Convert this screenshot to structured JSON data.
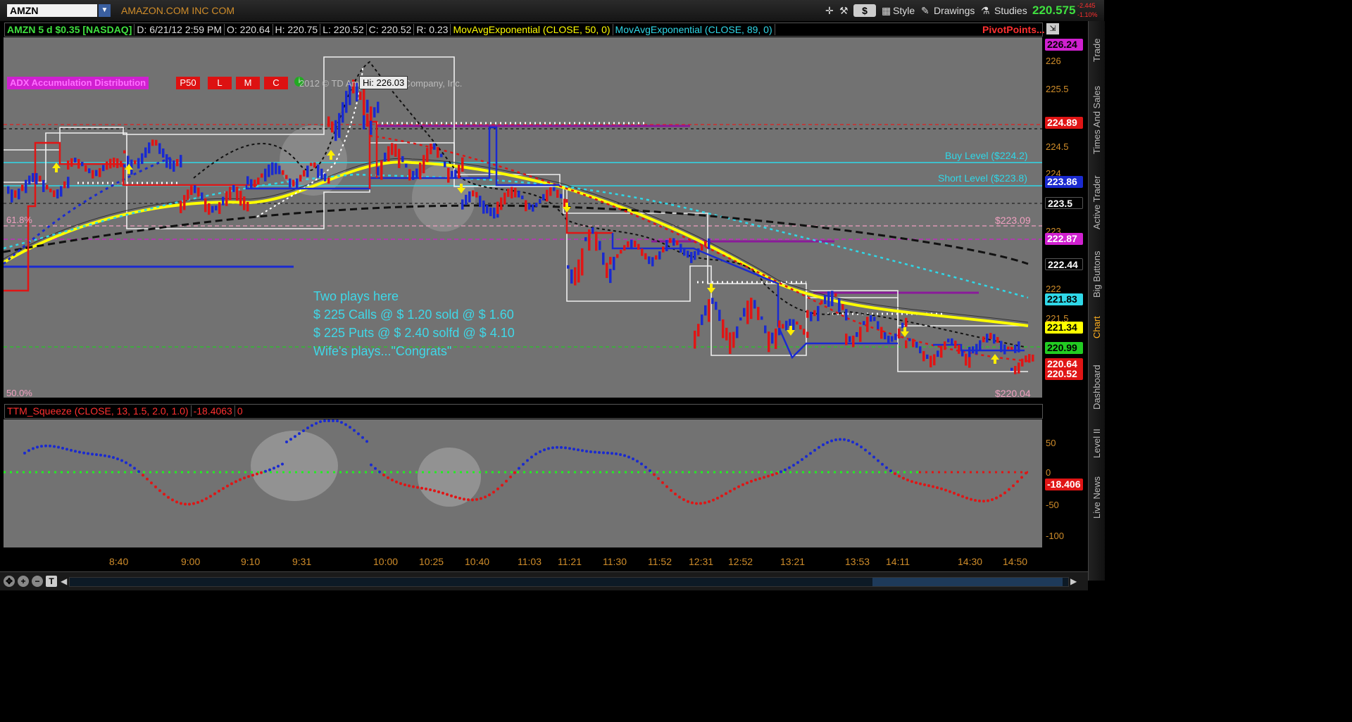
{
  "header": {
    "symbol": "AMZN",
    "company": "AMAZON.COM INC COM",
    "dollar_btn": "$",
    "style": "Style",
    "drawings": "Drawings",
    "studies": "Studies",
    "last": "220.575",
    "chg_abs": "-2.445",
    "chg_pct": "-1.10%"
  },
  "infobar": {
    "desc": "AMZN 5 d $0.35 [NASDAQ]",
    "date": "D: 6/21/12 2:59 PM",
    "open": "O: 220.64",
    "high": "H: 220.75",
    "low": "L: 220.52",
    "close": "C: 220.52",
    "range": "R: 0.23",
    "ema50": "MovAvgExponential (CLOSE, 50, 0)",
    "ema89": "MovAvgExponential (CLOSE, 89, 0)",
    "pivots": "PivotPoints..."
  },
  "accum": {
    "label": "ADX Accumulation Distribution",
    "boxes": [
      "P50",
      "L",
      "M",
      "C"
    ]
  },
  "copyright": "2012 © TD Ameritrade IP Company, Inc.",
  "hi_tip": "Hi: 226.03",
  "levels": {
    "buy": "Buy Level ($224.2)",
    "short": "Short Level ($223.8)",
    "fib618": "61.8%",
    "fib50": "50.0%",
    "p223_09": "$223.09",
    "p220_04": "$220.04"
  },
  "note": [
    "Two plays here",
    "$ 225 Calls @ $ 1.20 sold @ $ 1.60",
    "$ 225 Puts @ $ 2.40 solfd @ $ 4.10",
    "Wife's plays...\"Congrats\""
  ],
  "price_axis": {
    "labels": [
      "226",
      "225.5",
      "224.5",
      "224",
      "223",
      "222",
      "221.5",
      "221"
    ],
    "tags": [
      {
        "v": "226.24",
        "bg": "#d020d0",
        "fg": "#000"
      },
      {
        "v": "224.89",
        "bg": "#e01515",
        "fg": "#fff"
      },
      {
        "v": "223.86",
        "bg": "#1a2ad0",
        "fg": "#fff"
      },
      {
        "v": "223.5",
        "bg": "#000",
        "fg": "#fff"
      },
      {
        "v": "222.87",
        "bg": "#d020d0",
        "fg": "#fff"
      },
      {
        "v": "222.44",
        "bg": "#000",
        "fg": "#fff"
      },
      {
        "v": "221.83",
        "bg": "#2fd8e8",
        "fg": "#000"
      },
      {
        "v": "221.34",
        "bg": "#ffff00",
        "fg": "#000"
      },
      {
        "v": "220.99",
        "bg": "#22cc22",
        "fg": "#000"
      },
      {
        "v": "220.64",
        "bg": "#e01515",
        "fg": "#fff"
      },
      {
        "v": "220.52",
        "bg": "#e01515",
        "fg": "#fff"
      }
    ]
  },
  "lower": {
    "label": "TTM_Squeeze (CLOSE, 13, 1.5, 2.0, 1.0)",
    "value": "-18.4063",
    "zero": "0",
    "axis": [
      "50",
      "0",
      "-50",
      "-100"
    ],
    "tag": "-18.406"
  },
  "time_axis": [
    "8:40",
    "9:00",
    "9:10",
    "9:31",
    "10:00",
    "10:25",
    "10:40",
    "11:03",
    "11:21",
    "11:30",
    "11:52",
    "12:31",
    "12:52",
    "13:21",
    "13:53",
    "14:11",
    "14:30",
    "14:50"
  ],
  "side_tabs": [
    "Trade",
    "Times And Sales",
    "Active Trader",
    "Big Buttons",
    "Chart",
    "Dashboard",
    "Level II",
    "Live News"
  ],
  "colors": {
    "up": "#1a2ad0",
    "down": "#e01515",
    "ema50": "#ffff00",
    "ema89": "#2fd8e8",
    "accent": "#d08d2a"
  }
}
